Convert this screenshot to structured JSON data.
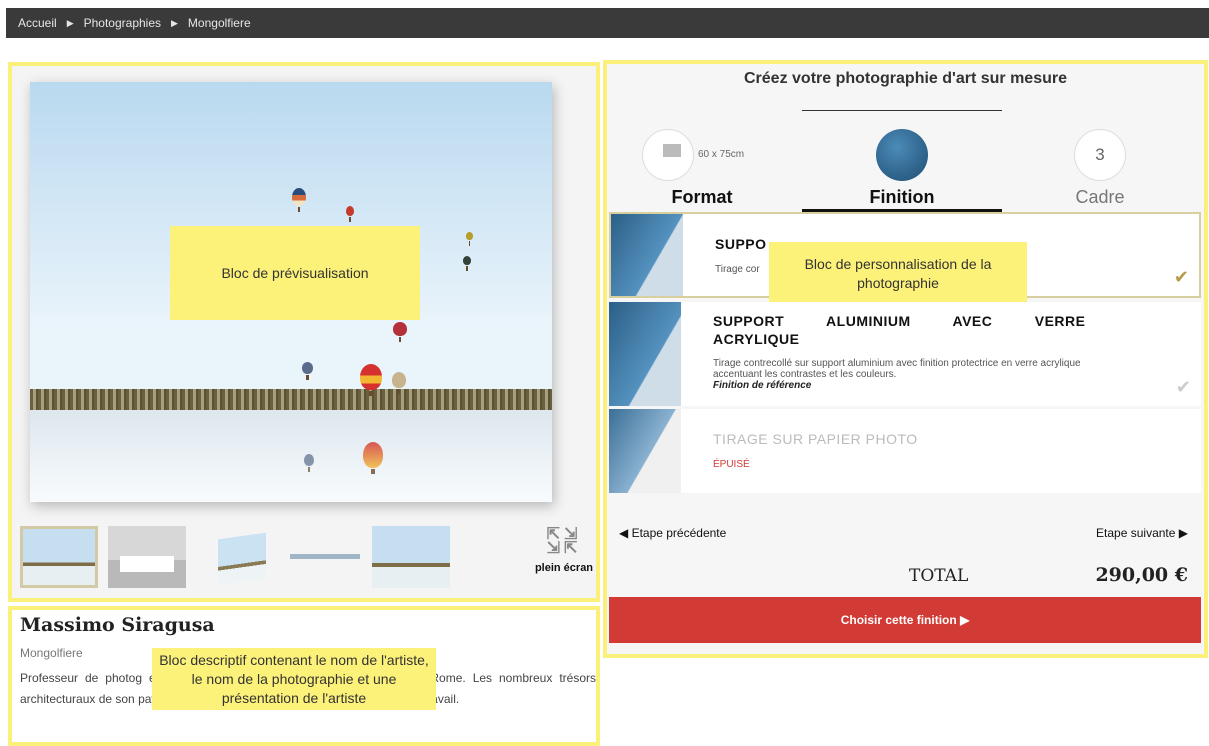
{
  "breadcrumb": {
    "items": [
      "Accueil",
      "Photographies",
      "Mongolfiere"
    ]
  },
  "preview": {
    "note": "Bloc de prévisualisation",
    "fullscreen_label": "plein écran"
  },
  "customize": {
    "title": "Créez votre photographie d'art sur mesure",
    "steps": [
      {
        "label": "Format",
        "detail": "60 x 75cm"
      },
      {
        "label": "Finition",
        "detail": ""
      },
      {
        "label": "Cadre",
        "detail": "3"
      }
    ],
    "note": "Bloc de personnalisation de la photographie",
    "options": [
      {
        "title": "SUPPO",
        "desc": "Tirage cor"
      },
      {
        "title": "SUPPORT ALUMINIUM AVEC VERRE ACRYLIQUE",
        "desc": "Tirage contrecollé sur support aluminium avec finition protectrice en verre acrylique accentuant les contrastes et les couleurs.",
        "note": "Finition de référence"
      },
      {
        "title": "TIRAGE SUR PAPIER PHOTO",
        "status": "ÉPUISÉ"
      }
    ],
    "prev_label": "Etape précédente",
    "next_label": "Etape suivante",
    "total_label": "TOTAL",
    "total_value": "290,00 €",
    "cta_label": "Choisir cette finition"
  },
  "description": {
    "artist": "Massimo Siragusa",
    "photo_name": "Mongolfiere",
    "note": "Bloc descriptif contenant le nom de l'artiste, le nom de la photographie et une présentation de l'artiste",
    "bio": "Professeur de photog                                    een de Design, Massimo Siragusa est né en                                         à Rome. Les nombreux trésors architecturaux de son pays forment la principale source d'inspiration de son travail."
  },
  "colors": {
    "highlight": "#fcf27a",
    "cta": "#d13a35",
    "topbar": "#3a3a3a"
  }
}
